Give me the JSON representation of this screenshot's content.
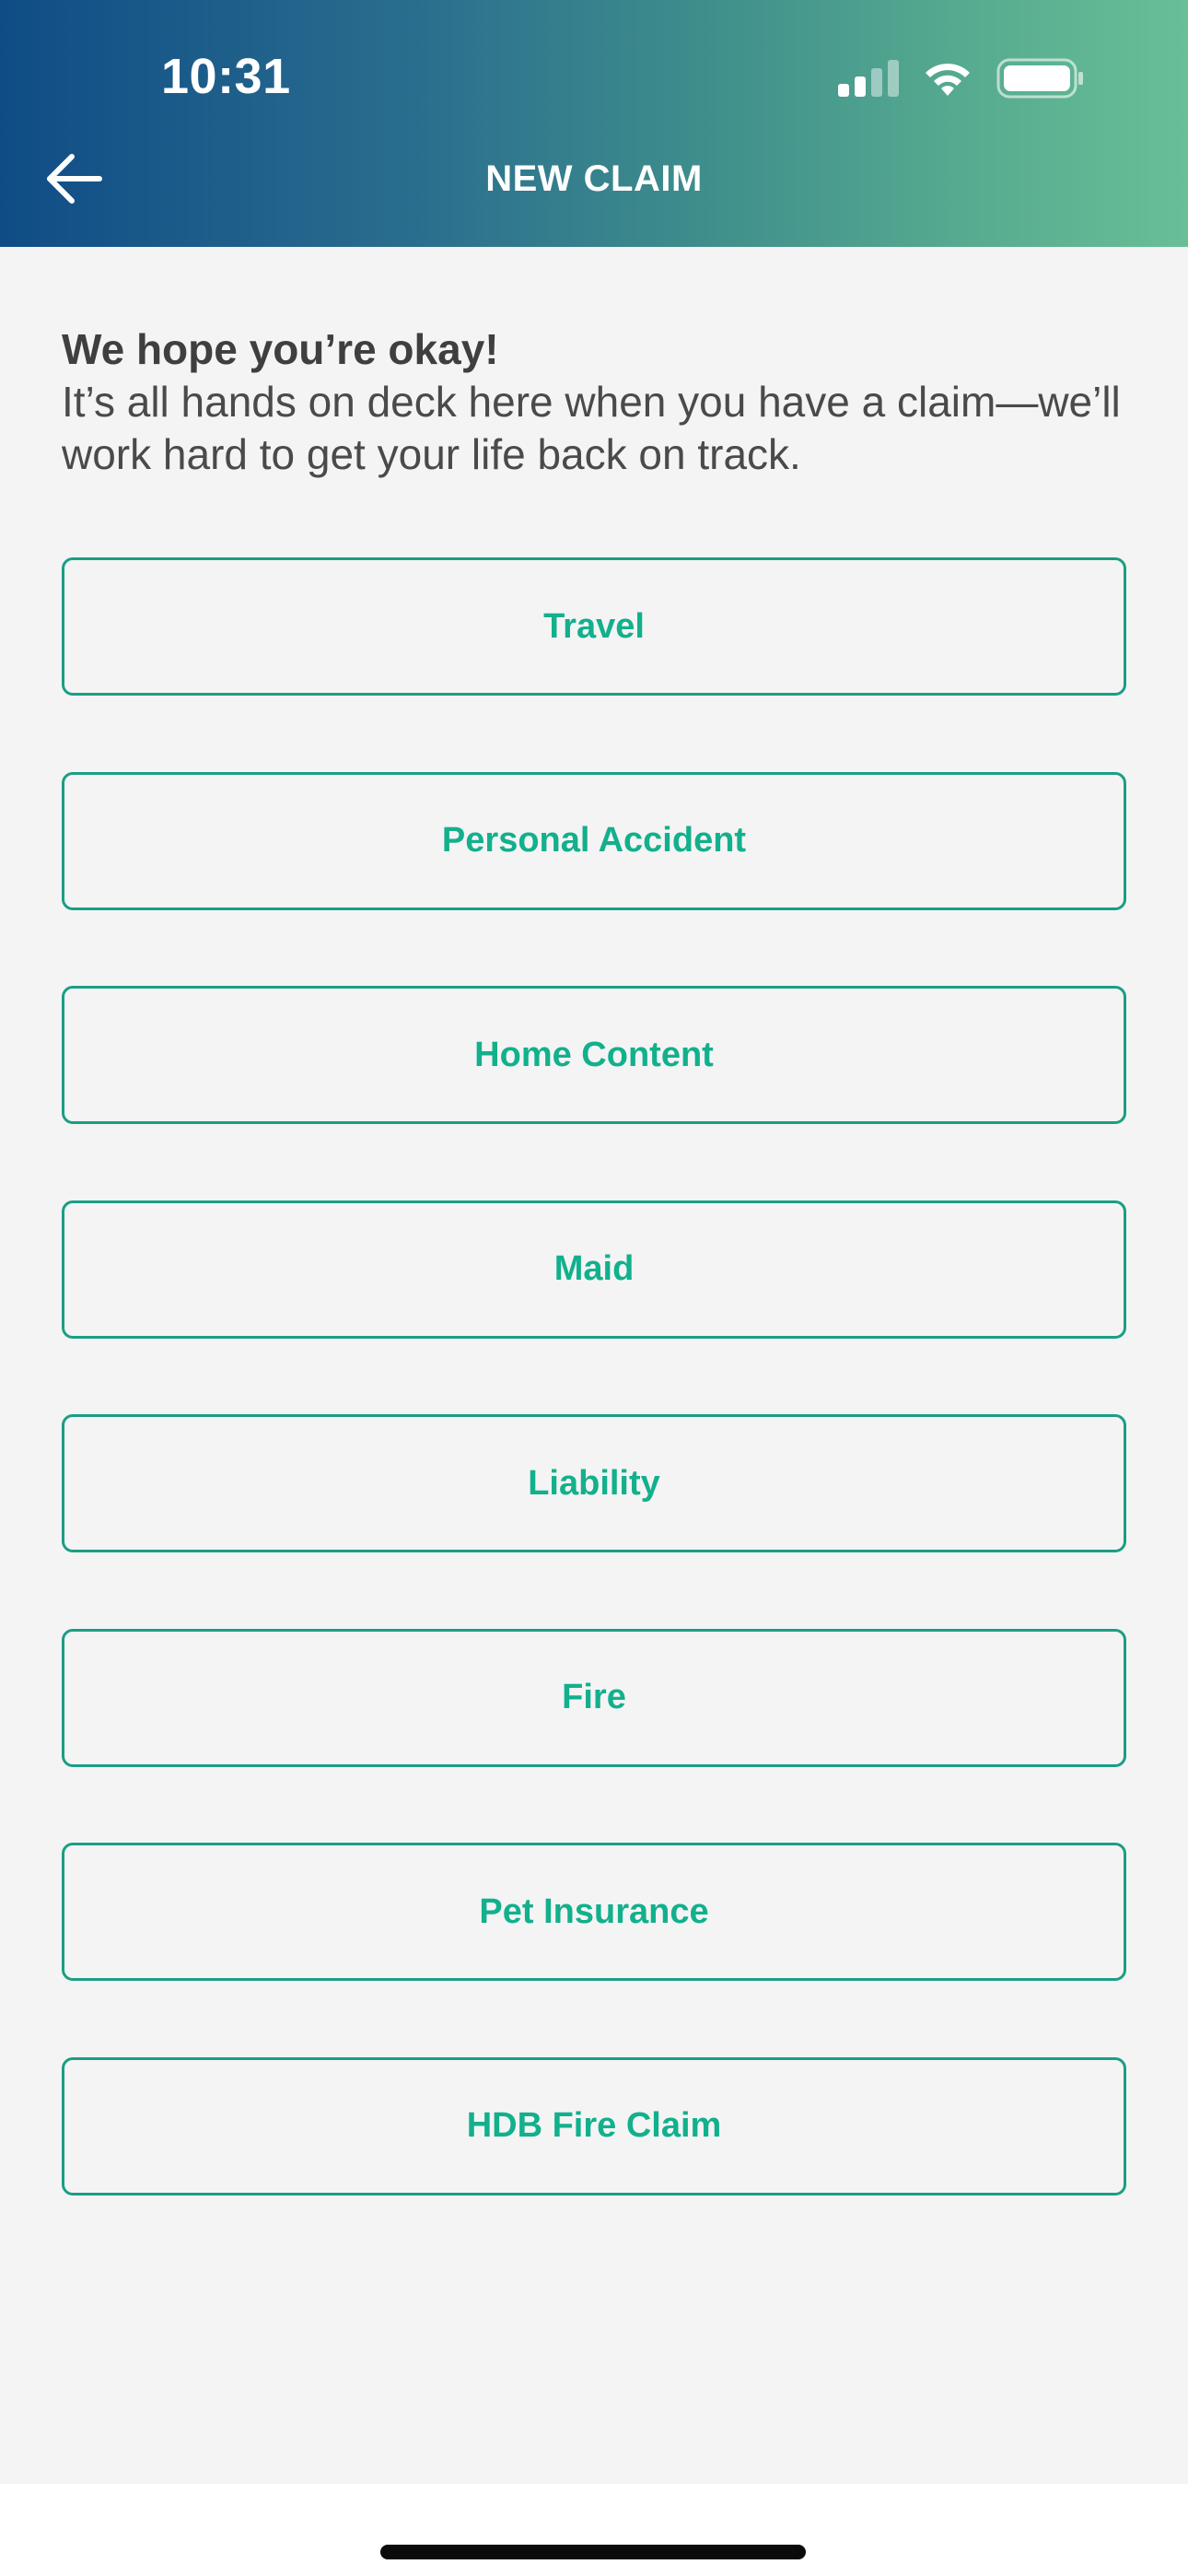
{
  "status_bar": {
    "time": "10:31"
  },
  "header": {
    "title": "NEW CLAIM",
    "back_icon": "arrow-left-icon"
  },
  "intro": {
    "heading": "We hope you’re okay!",
    "body": "It’s all hands on deck here when you have a claim—we’ll work hard to get your life back on track."
  },
  "claim_types": [
    {
      "label": "Travel"
    },
    {
      "label": "Personal Accident"
    },
    {
      "label": "Home Content"
    },
    {
      "label": "Maid"
    },
    {
      "label": "Liability"
    },
    {
      "label": "Fire"
    },
    {
      "label": "Pet Insurance"
    },
    {
      "label": "HDB Fire Claim"
    }
  ],
  "colors": {
    "accent": "#12b08c",
    "border": "#1a9e84",
    "header_gradient_start": "#0f4c86",
    "header_gradient_end": "#68bf96",
    "background": "#f4f4f4"
  }
}
